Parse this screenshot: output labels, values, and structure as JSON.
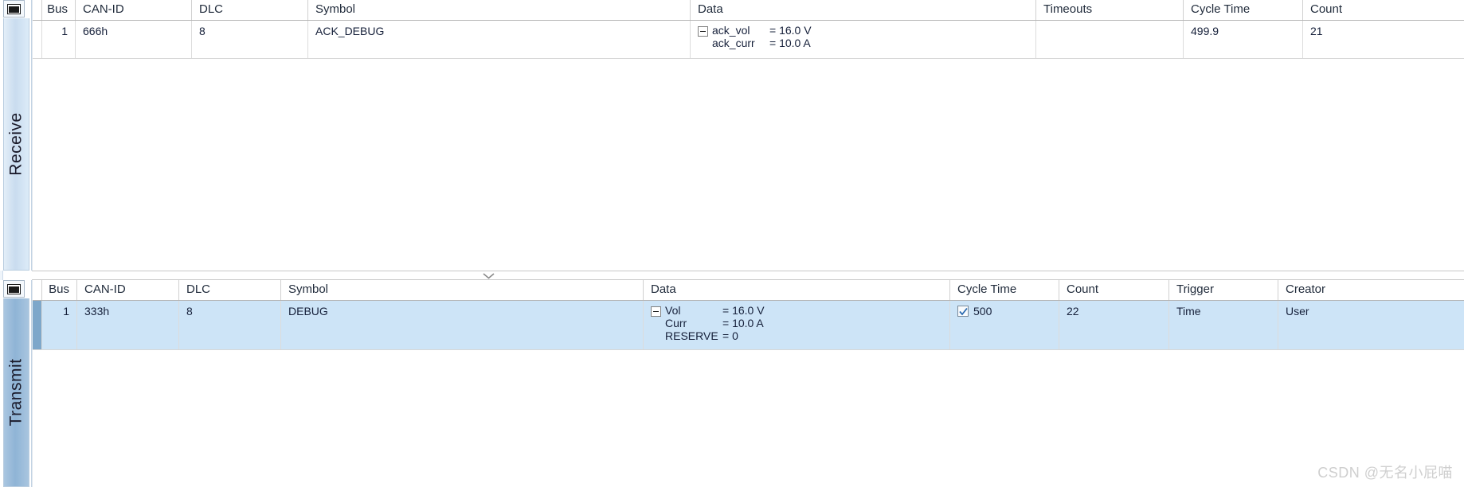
{
  "watermark": "CSDN @无名小屁喵",
  "splitter": {
    "handle_icon": "chevron-down-icon"
  },
  "receive": {
    "tab_label": "Receive",
    "toggle_icon": "select-all-icon",
    "columns": [
      "Bus",
      "CAN-ID",
      "DLC",
      "Symbol",
      "Data",
      "Timeouts",
      "Cycle Time",
      "Count"
    ],
    "rows": [
      {
        "bus": "1",
        "can_id": "666h",
        "dlc": "8",
        "symbol": "ACK_DEBUG",
        "data": [
          {
            "expander": "minus",
            "name": "ack_vol",
            "value": "= 16.0 V"
          },
          {
            "expander": "none",
            "name": "ack_curr",
            "value": "= 10.0 A"
          }
        ],
        "timeouts": "",
        "cycle_time": "499.9",
        "count": "21"
      }
    ]
  },
  "transmit": {
    "tab_label": "Transmit",
    "toggle_icon": "select-all-icon",
    "columns": [
      "Bus",
      "CAN-ID",
      "DLC",
      "Symbol",
      "Data",
      "Cycle Time",
      "Count",
      "Trigger",
      "Creator"
    ],
    "rows": [
      {
        "bus": "1",
        "can_id": "333h",
        "dlc": "8",
        "symbol": "DEBUG",
        "data": [
          {
            "expander": "minus",
            "name": "Vol",
            "value": "= 16.0 V"
          },
          {
            "expander": "none",
            "name": "Curr",
            "value": "= 10.0 A"
          },
          {
            "expander": "none",
            "name": "RESERVE",
            "value": "= 0"
          }
        ],
        "cycle_time_checked": true,
        "cycle_time": "500",
        "count": "22",
        "trigger": "Time",
        "creator": "User",
        "selected": true
      }
    ]
  },
  "colors": {
    "selection_row": "#cde4f7",
    "selection_gutter": "#7da7ca",
    "receive_tab": "#c9dcef",
    "transmit_tab": "#8fb4d6",
    "header_text": "#1f2a3a",
    "watermark": "#cfcfcf"
  }
}
